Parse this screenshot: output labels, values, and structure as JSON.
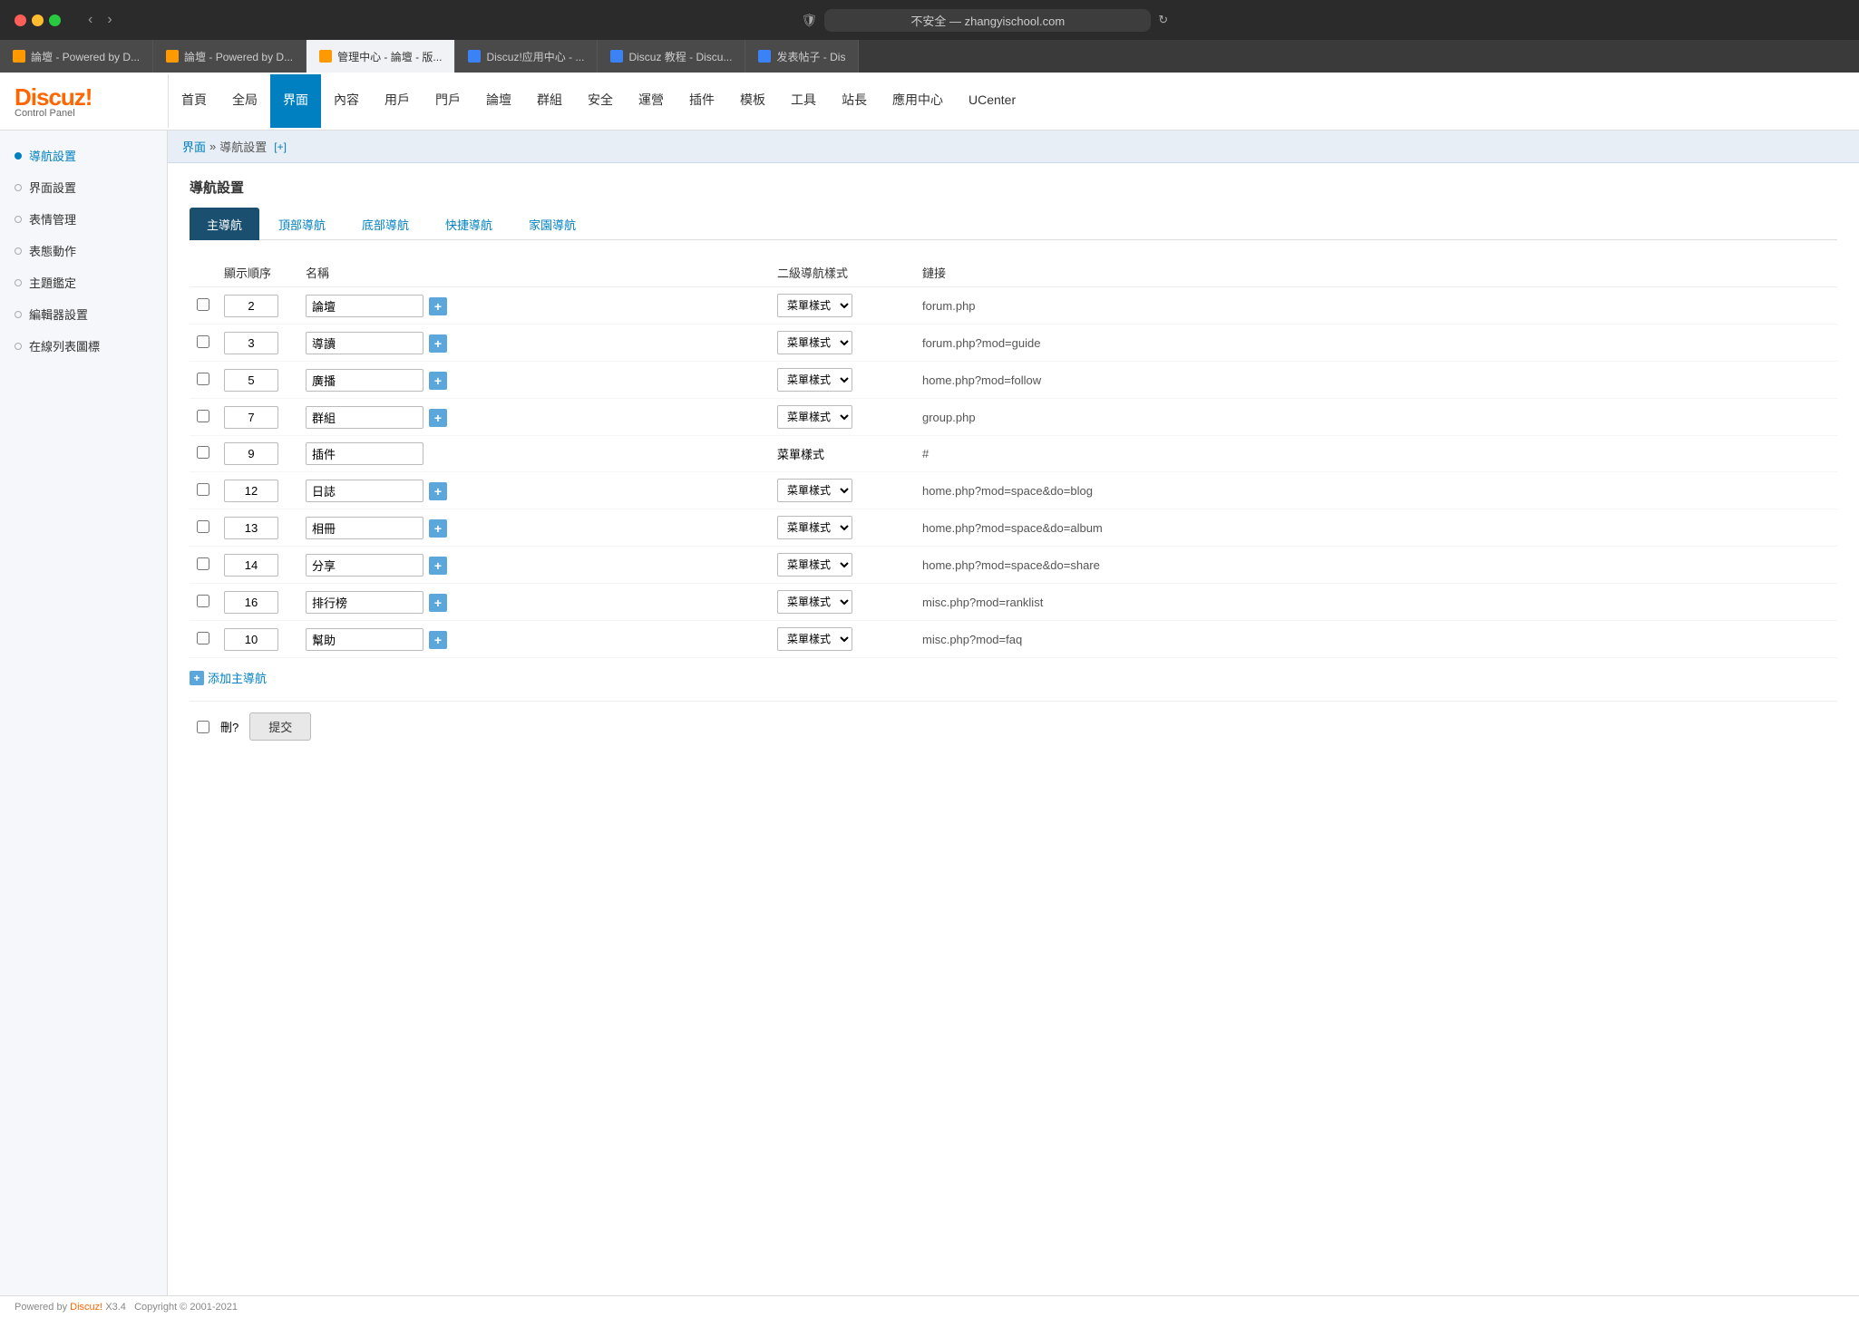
{
  "titlebar": {
    "title": "不安全 — zhangyischool.com",
    "url": "不安全 — zhangyischool.com"
  },
  "tabs": [
    {
      "label": "論壇 - Powered by D...",
      "active": false,
      "color": "orange"
    },
    {
      "label": "論壇 - Powered by D...",
      "active": false,
      "color": "orange"
    },
    {
      "label": "管理中心 - 論壇 - 版...",
      "active": true,
      "color": "orange"
    },
    {
      "label": "Discuz!应用中心 - ...",
      "active": false,
      "color": "blue"
    },
    {
      "label": "Discuz 教程 - Discu...",
      "active": false,
      "color": "blue"
    },
    {
      "label": "发表帖子 - Dis",
      "active": false,
      "color": "blue"
    }
  ],
  "logo": {
    "name": "Discuz!",
    "sub": "Control Panel"
  },
  "menu": {
    "items": [
      {
        "label": "首頁",
        "active": false
      },
      {
        "label": "全局",
        "active": false
      },
      {
        "label": "界面",
        "active": true
      },
      {
        "label": "內容",
        "active": false
      },
      {
        "label": "用戶",
        "active": false
      },
      {
        "label": "門戶",
        "active": false
      },
      {
        "label": "論壇",
        "active": false
      },
      {
        "label": "群組",
        "active": false
      },
      {
        "label": "安全",
        "active": false
      },
      {
        "label": "運營",
        "active": false
      },
      {
        "label": "插件",
        "active": false
      },
      {
        "label": "模板",
        "active": false
      },
      {
        "label": "工具",
        "active": false
      },
      {
        "label": "站長",
        "active": false
      },
      {
        "label": "應用中心",
        "active": false
      },
      {
        "label": "UCenter",
        "active": false
      }
    ]
  },
  "sidebar": {
    "items": [
      {
        "label": "導航設置",
        "active": true
      },
      {
        "label": "界面設置",
        "active": false
      },
      {
        "label": "表情管理",
        "active": false
      },
      {
        "label": "表態動作",
        "active": false
      },
      {
        "label": "主題鑑定",
        "active": false
      },
      {
        "label": "編輯器設置",
        "active": false
      },
      {
        "label": "在線列表圖標",
        "active": false
      }
    ]
  },
  "breadcrumb": {
    "root": "界面",
    "current": "導航設置",
    "add": "[+]"
  },
  "page_title": "導航設置",
  "sub_tabs": [
    {
      "label": "主導航",
      "active": true
    },
    {
      "label": "頂部導航",
      "active": false
    },
    {
      "label": "底部導航",
      "active": false
    },
    {
      "label": "快捷導航",
      "active": false
    },
    {
      "label": "家園導航",
      "active": false
    }
  ],
  "table": {
    "headers": {
      "order": "顯示順序",
      "name": "名稱",
      "style": "二級導航樣式",
      "link": "鏈接"
    },
    "rows": [
      {
        "order": "2",
        "name": "論壇",
        "has_plus": true,
        "style": "菜單樣式",
        "link": "forum.php"
      },
      {
        "order": "3",
        "name": "導讀",
        "has_plus": true,
        "style": "菜單樣式",
        "link": "forum.php?mod=guide"
      },
      {
        "order": "5",
        "name": "廣播",
        "has_plus": true,
        "style": "菜單樣式",
        "link": "home.php?mod=follow"
      },
      {
        "order": "7",
        "name": "群組",
        "has_plus": true,
        "style": "菜單樣式",
        "link": "group.php"
      },
      {
        "order": "9",
        "name": "插件",
        "has_plus": false,
        "style": "菜單樣式",
        "link": "#"
      },
      {
        "order": "12",
        "name": "日誌",
        "has_plus": true,
        "style": "菜單樣式",
        "link": "home.php?mod=space&do=blog"
      },
      {
        "order": "13",
        "name": "相冊",
        "has_plus": true,
        "style": "菜單樣式",
        "link": "home.php?mod=space&do=album"
      },
      {
        "order": "14",
        "name": "分享",
        "has_plus": true,
        "style": "菜單樣式",
        "link": "home.php?mod=space&do=share"
      },
      {
        "order": "16",
        "name": "排行榜",
        "has_plus": true,
        "style": "菜單樣式",
        "link": "misc.php?mod=ranklist"
      },
      {
        "order": "10",
        "name": "幫助",
        "has_plus": true,
        "style": "菜單樣式",
        "link": "misc.php?mod=faq"
      }
    ]
  },
  "add_nav_label": "添加主導航",
  "bottom": {
    "del_label": "刪?",
    "submit_label": "提交"
  },
  "footer": {
    "powered_by": "Powered by",
    "brand": "Discuz!",
    "version": "X3.4",
    "copyright": "Copyright © 2001-2021"
  }
}
